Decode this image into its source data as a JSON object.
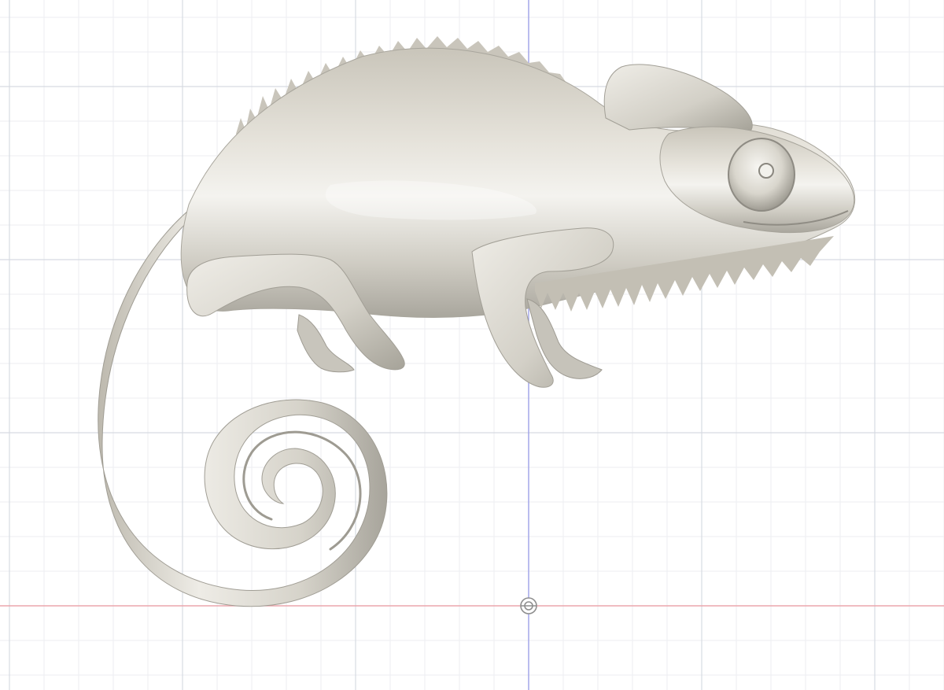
{
  "viewport": {
    "kind": "3d-modeling-canvas",
    "view": "front",
    "grid": true,
    "colors": {
      "background": "#ffffff",
      "grid_minor": "#eceef2",
      "grid_major": "#d7dbe2",
      "axis_vertical": "#9a9de8",
      "axis_horizontal": "#ee9aa0",
      "model_base": "#d8d5cc",
      "model_highlight": "#f6f5f0",
      "model_shadow": "#9c998f"
    }
  },
  "model": {
    "subject": "chameleon",
    "material": "matte-silver"
  },
  "origin": {
    "icon": "origin-target-icon"
  }
}
